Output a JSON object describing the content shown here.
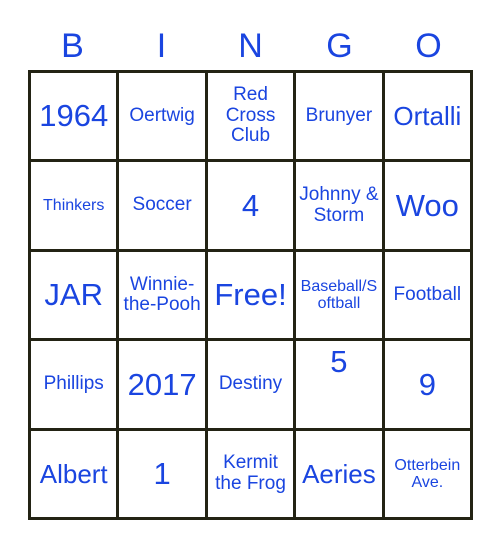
{
  "card": {
    "title": "BINGO",
    "text_color": "#1a45e0",
    "border_color": "#232314",
    "background_color": "#ffffff"
  },
  "header": {
    "letters": [
      {
        "label": "B"
      },
      {
        "label": "I"
      },
      {
        "label": "N"
      },
      {
        "label": "G"
      },
      {
        "label": "O"
      }
    ]
  },
  "grid": {
    "rows": 5,
    "columns": 5,
    "cells": [
      [
        {
          "text": "1964",
          "size": "sz-xl",
          "align": "va-center"
        },
        {
          "text": "Oertwig",
          "size": "sz-md",
          "align": "va-center"
        },
        {
          "text": "Red Cross Club",
          "size": "sz-md",
          "align": "va-center"
        },
        {
          "text": "Brunyer",
          "size": "sz-md",
          "align": "va-center"
        },
        {
          "text": "Ortalli",
          "size": "sz-lg",
          "align": "va-center"
        }
      ],
      [
        {
          "text": "Thinkers",
          "size": "sz-sm",
          "align": "va-center"
        },
        {
          "text": "Soccer",
          "size": "sz-md",
          "align": "va-center"
        },
        {
          "text": "4",
          "size": "sz-xl",
          "align": "va-center"
        },
        {
          "text": "Johnny & Storm",
          "size": "sz-md",
          "align": "va-center"
        },
        {
          "text": "Woo",
          "size": "sz-xl",
          "align": "va-center"
        }
      ],
      [
        {
          "text": "JAR",
          "size": "sz-xl",
          "align": "va-center"
        },
        {
          "text": "Winnie-the-Pooh",
          "size": "sz-md",
          "align": "va-center"
        },
        {
          "text": "Free!",
          "size": "sz-xl",
          "align": "va-center"
        },
        {
          "text": "Baseball/Softball",
          "size": "sz-sm",
          "align": "va-center"
        },
        {
          "text": "Football",
          "size": "sz-md",
          "align": "va-center"
        }
      ],
      [
        {
          "text": "Phillips",
          "size": "sz-md",
          "align": "va-center"
        },
        {
          "text": "2017",
          "size": "sz-xl",
          "align": "va-center"
        },
        {
          "text": "Destiny",
          "size": "sz-md",
          "align": "va-center"
        },
        {
          "text": "5",
          "size": "sz-xl",
          "align": "va-top"
        },
        {
          "text": "9",
          "size": "sz-xl",
          "align": "va-center"
        }
      ],
      [
        {
          "text": "Albert",
          "size": "sz-lg",
          "align": "va-center"
        },
        {
          "text": "1",
          "size": "sz-xl",
          "align": "va-center"
        },
        {
          "text": "Kermit the Frog",
          "size": "sz-md",
          "align": "va-center"
        },
        {
          "text": "Aeries",
          "size": "sz-lg",
          "align": "va-center"
        },
        {
          "text": "Otterbein Ave.",
          "size": "sz-sm",
          "align": "va-center"
        }
      ]
    ]
  }
}
